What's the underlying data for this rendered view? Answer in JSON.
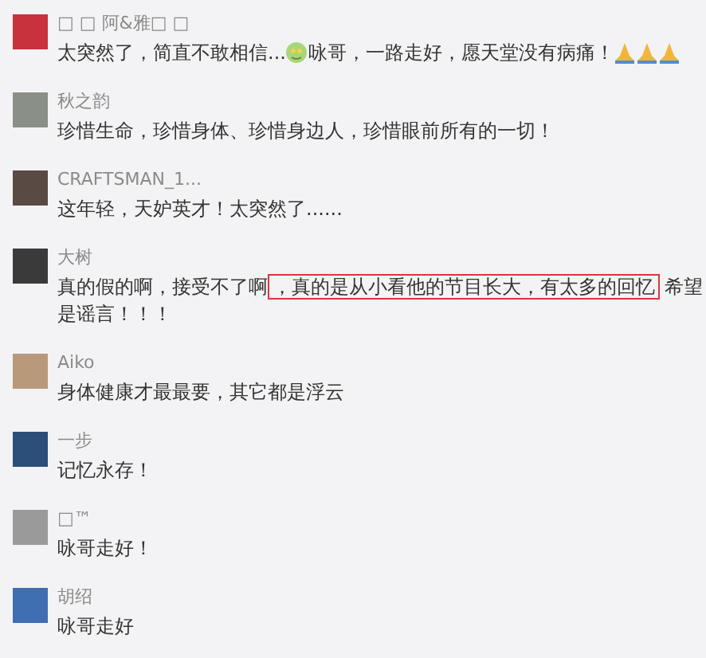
{
  "comments": [
    {
      "name": "□ □ 阿&雅□ □",
      "parts": [
        {
          "kind": "text",
          "text": "太突然了，简直不敢相信..."
        },
        {
          "kind": "face-emoji"
        },
        {
          "kind": "text",
          "text": "咏哥，一路走好，愿天堂没有病痛！"
        },
        {
          "kind": "pray-emoji"
        },
        {
          "kind": "pray-emoji"
        },
        {
          "kind": "pray-emoji"
        }
      ]
    },
    {
      "name": "秋之韵",
      "parts": [
        {
          "kind": "text",
          "text": "珍惜生命，珍惜身体、珍惜身边人，珍惜眼前所有的一切！"
        }
      ]
    },
    {
      "name": "CRAFTSMAN_1...",
      "parts": [
        {
          "kind": "text",
          "text": "这年轻，天妒英才！太突然了......"
        }
      ]
    },
    {
      "name": "大树",
      "parts": [
        {
          "kind": "text",
          "text": "真的假的啊，接受不了啊"
        },
        {
          "kind": "highlight",
          "text": "，真的是从小看他的节目长大，有太多的回忆"
        },
        {
          "kind": "text",
          "text": "希望是谣言！！！"
        }
      ]
    },
    {
      "name": "Aiko",
      "parts": [
        {
          "kind": "text",
          "text": "身体健康才最最要，其它都是浮云"
        }
      ]
    },
    {
      "name": "一步",
      "parts": [
        {
          "kind": "text",
          "text": "记忆永存！"
        }
      ]
    },
    {
      "name": "□™",
      "parts": [
        {
          "kind": "text",
          "text": "咏哥走好！"
        }
      ]
    },
    {
      "name": "胡绍",
      "parts": [
        {
          "kind": "text",
          "text": "咏哥走好"
        }
      ]
    }
  ]
}
